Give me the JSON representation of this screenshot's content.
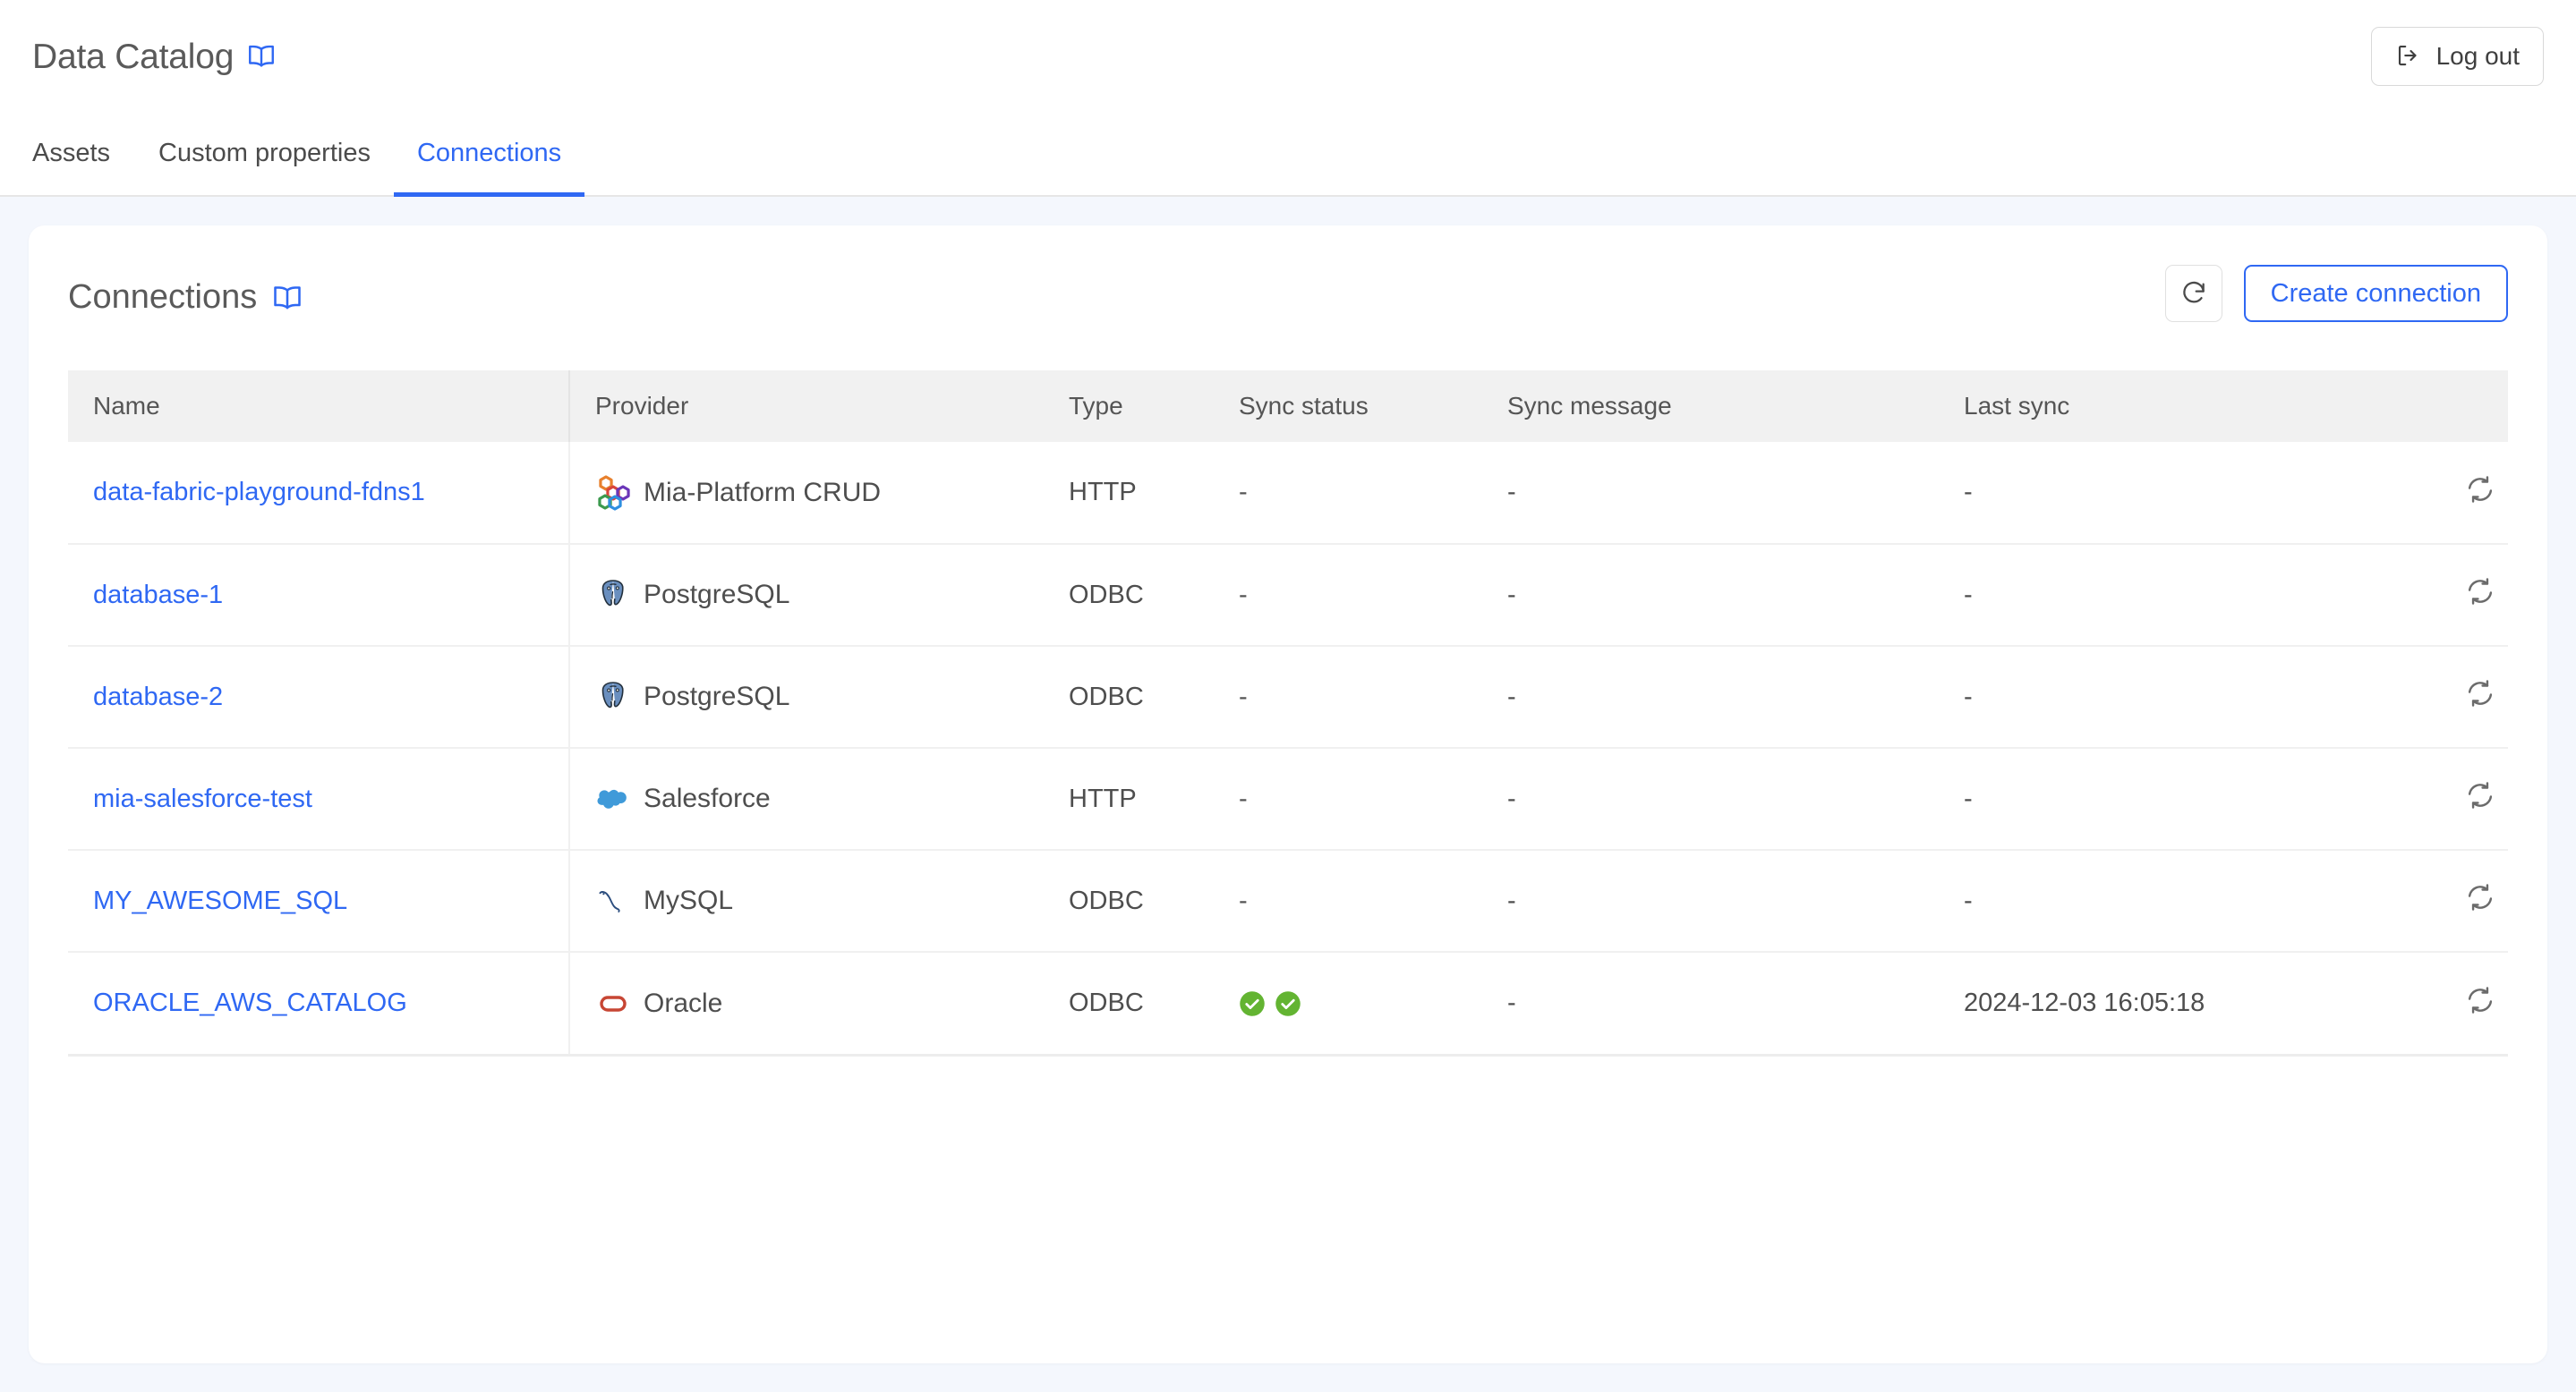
{
  "header": {
    "app_title": "Data Catalog",
    "book_icon": "book-icon",
    "logout_label": "Log out",
    "logout_icon": "logout-icon"
  },
  "tabs": [
    {
      "label": "Assets",
      "active": false
    },
    {
      "label": "Custom properties",
      "active": false
    },
    {
      "label": "Connections",
      "active": true
    }
  ],
  "card": {
    "title": "Connections",
    "book_icon": "book-icon",
    "refresh_icon": "refresh-icon",
    "create_label": "Create connection"
  },
  "table": {
    "columns": [
      "Name",
      "Provider",
      "Type",
      "Sync status",
      "Sync message",
      "Last sync"
    ],
    "row_action_icon": "sync-icon",
    "rows": [
      {
        "name": "data-fabric-playground-fdns1",
        "provider": "Mia-Platform CRUD",
        "provider_icon": "mia-platform-icon",
        "type": "HTTP",
        "sync_status": [],
        "sync_status_text": "-",
        "sync_message": "-",
        "last_sync": "-"
      },
      {
        "name": "database-1",
        "provider": "PostgreSQL",
        "provider_icon": "postgresql-icon",
        "type": "ODBC",
        "sync_status": [],
        "sync_status_text": "-",
        "sync_message": "-",
        "last_sync": "-"
      },
      {
        "name": "database-2",
        "provider": "PostgreSQL",
        "provider_icon": "postgresql-icon",
        "type": "ODBC",
        "sync_status": [],
        "sync_status_text": "-",
        "sync_message": "-",
        "last_sync": "-"
      },
      {
        "name": "mia-salesforce-test",
        "provider": "Salesforce",
        "provider_icon": "salesforce-icon",
        "type": "HTTP",
        "sync_status": [],
        "sync_status_text": "-",
        "sync_message": "-",
        "last_sync": "-"
      },
      {
        "name": "MY_AWESOME_SQL",
        "provider": "MySQL",
        "provider_icon": "mysql-icon",
        "type": "ODBC",
        "sync_status": [],
        "sync_status_text": "-",
        "sync_message": "-",
        "last_sync": "-"
      },
      {
        "name": "ORACLE_AWS_CATALOG",
        "provider": "Oracle",
        "provider_icon": "oracle-icon",
        "type": "ODBC",
        "sync_status": [
          "success",
          "success"
        ],
        "sync_status_text": "",
        "sync_message": "-",
        "last_sync": "2024-12-03 16:05:18"
      }
    ]
  },
  "colors": {
    "accent": "#2f68f3",
    "page_bg": "#f4f7fd",
    "header_bg": "#f1f1f1",
    "success": "#63b432",
    "text": "#4e4e4e"
  }
}
